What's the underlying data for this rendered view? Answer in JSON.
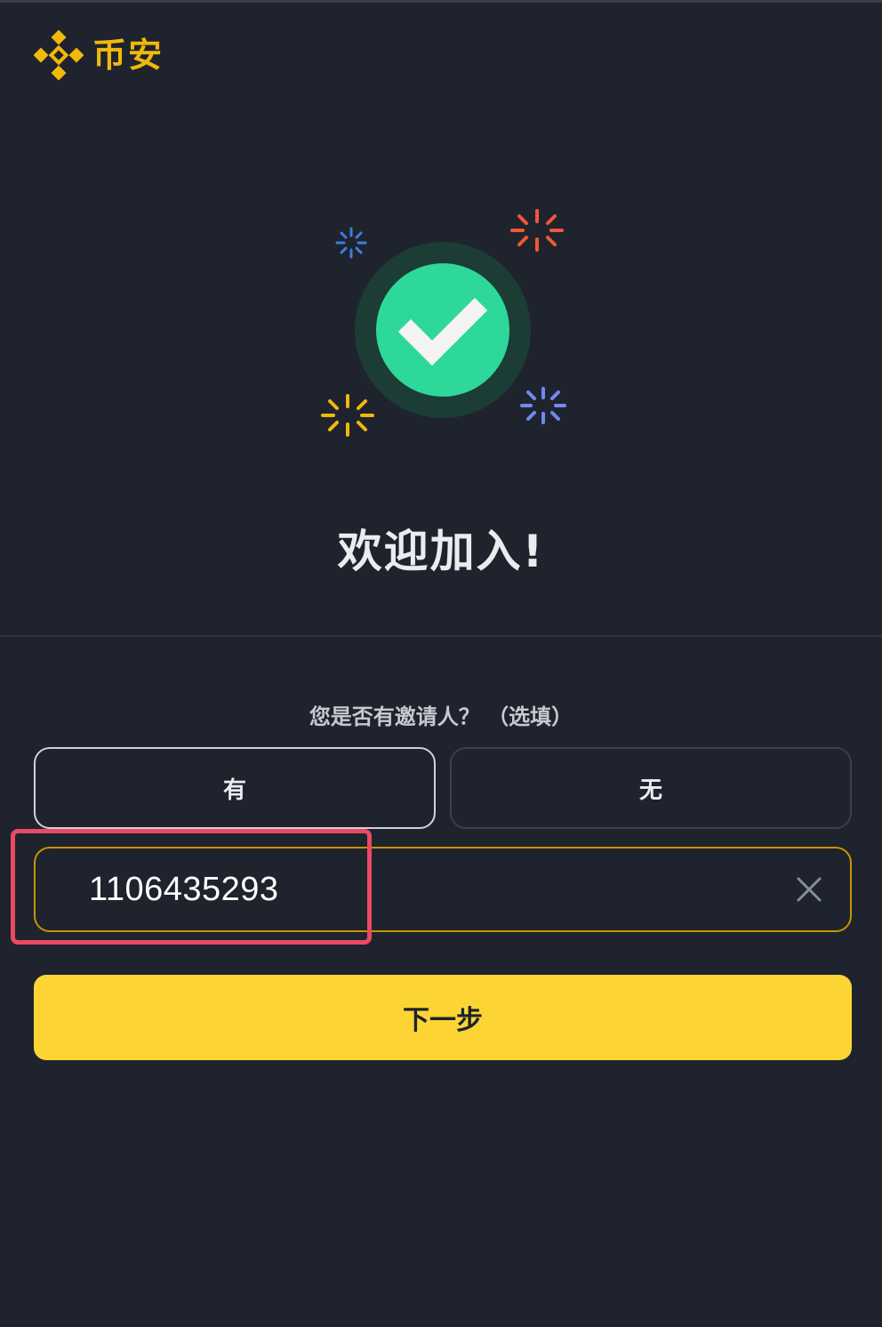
{
  "brand": {
    "name": "币安",
    "color": "#f0b90b",
    "logo_icon": "binance-logo-icon"
  },
  "hero": {
    "icon": "success-check-icon",
    "sparkle_colors": [
      "#3d7ee0",
      "#f0573a",
      "#f0b90b",
      "#6e8bf0"
    ],
    "check_color": "#2ed89a"
  },
  "welcome": {
    "title": "欢迎加入!"
  },
  "referral_question": {
    "label": "您是否有邀请人？ （选填）",
    "options": [
      {
        "label": "有",
        "selected": true
      },
      {
        "label": "无",
        "selected": false
      }
    ]
  },
  "referral_input": {
    "value": "1106435293",
    "clear_icon": "close-icon"
  },
  "next_button": {
    "label": "下一步",
    "color": "#fcd535"
  },
  "annotation": {
    "highlight_color": "#ea4a63"
  }
}
